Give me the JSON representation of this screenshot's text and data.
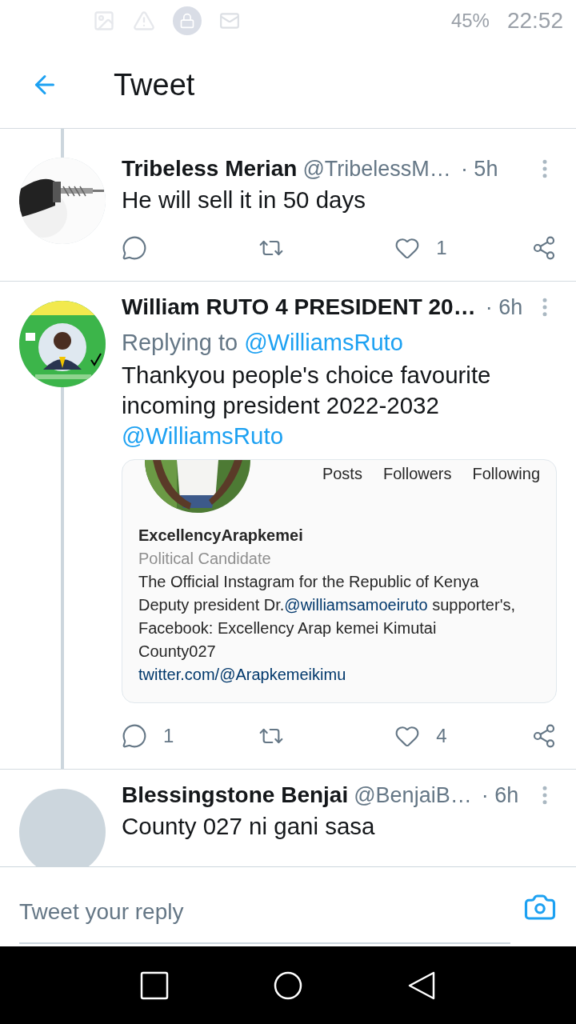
{
  "status_bar": {
    "battery": "45%",
    "time": "22:52"
  },
  "header": {
    "title": "Tweet"
  },
  "tweets": [
    {
      "avatar": {
        "kind": "picture"
      },
      "thread_above": true,
      "thread_below": false,
      "name": "Tribeless Merian",
      "handle": "@TribelessM…",
      "time": "· 5h",
      "text": [
        {
          "kind": "plain",
          "text": "He will sell it in 50 days"
        }
      ],
      "actions": [
        {
          "kind": "reply"
        },
        {
          "kind": "retweet"
        },
        {
          "kind": "like",
          "count": "1"
        },
        {
          "kind": "share"
        }
      ]
    },
    {
      "avatar": {
        "kind": "picture"
      },
      "thread_above": false,
      "thread_below": true,
      "name": "William RUTO 4 PRESIDENT 20…",
      "time": "· 6h",
      "replying": {
        "label": "Replying to",
        "mention": "@WilliamsRuto"
      },
      "text": [
        {
          "kind": "plain",
          "text": "Thankyou people's choice favourite incoming president 2022-2032 "
        },
        {
          "kind": "mention",
          "text": "@WilliamsRuto"
        }
      ],
      "card": {
        "stats": [
          "Posts",
          "Followers",
          "Following"
        ],
        "username": "ExcellencyArapkemei",
        "category": "Political Candidate",
        "bio": [
          {
            "kind": "plain",
            "text": "The Official Instagram for the Republic of Kenya\nDeputy president Dr."
          },
          {
            "kind": "mention",
            "text": "@williamsamoeiruto"
          },
          {
            "kind": "plain",
            "text": " supporter's,\nFacebook: Excellency Arap kemei Kimutai\nCounty027"
          }
        ],
        "link": "twitter.com/@Arapkemeikimu"
      },
      "actions": [
        {
          "kind": "reply",
          "count": "1"
        },
        {
          "kind": "retweet"
        },
        {
          "kind": "like",
          "count": "4"
        },
        {
          "kind": "share"
        }
      ]
    },
    {
      "avatar": {
        "kind": "plain"
      },
      "name": "Blessingstone Benjai",
      "handle": "@BenjaiB…",
      "time": "· 6h",
      "text": [
        {
          "kind": "plain",
          "text": "County 027 ni gani sasa"
        }
      ]
    }
  ],
  "reply_bar": {
    "placeholder": "Tweet your reply"
  }
}
